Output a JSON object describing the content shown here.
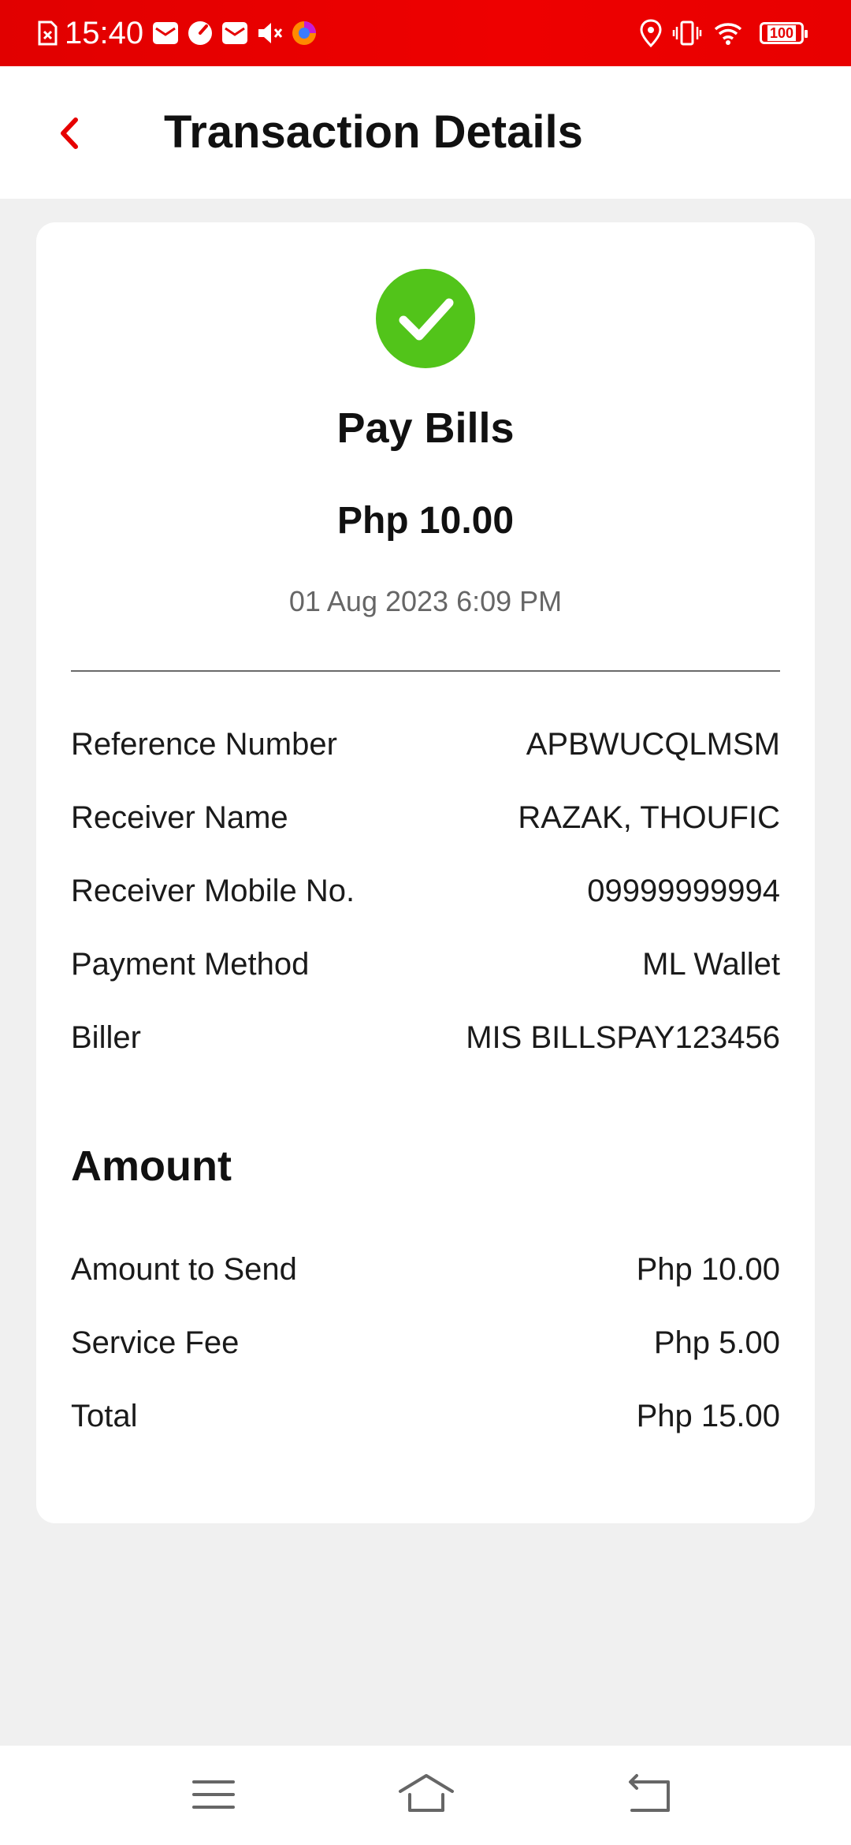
{
  "status_bar": {
    "time": "15:40",
    "battery": "100",
    "icons": [
      "sim-error-icon",
      "mail-icon",
      "gauge-icon",
      "mail-icon",
      "mute-icon",
      "browser-icon",
      "location-icon",
      "vibrate-icon",
      "wifi-icon",
      "battery-icon"
    ]
  },
  "header": {
    "title": "Transaction Details",
    "back_icon": "chevron-left-icon"
  },
  "transaction": {
    "status_icon": "check-circle-icon",
    "type": "Pay Bills",
    "amount": "Php 10.00",
    "datetime": "01 Aug 2023 6:09 PM"
  },
  "details": [
    {
      "label": "Reference Number",
      "value": "APBWUCQLMSM"
    },
    {
      "label": "Receiver Name",
      "value": "RAZAK, THOUFIC"
    },
    {
      "label": "Receiver Mobile No.",
      "value": "09999999994"
    },
    {
      "label": "Payment Method",
      "value": "ML Wallet"
    },
    {
      "label": "Biller",
      "value": "MIS BILLSPAY123456"
    }
  ],
  "amount_section": {
    "title": "Amount",
    "rows": [
      {
        "label": "Amount to Send",
        "value": "Php 10.00"
      },
      {
        "label": "Service Fee",
        "value": "Php 5.00"
      },
      {
        "label": "Total",
        "value": "Php 15.00"
      }
    ]
  },
  "nav_bar": {
    "icons": [
      "menu-icon",
      "home-icon",
      "back-icon"
    ]
  },
  "colors": {
    "brand_red": "#e60000",
    "success_green": "#52c41a",
    "background": "#f0f0f0"
  }
}
